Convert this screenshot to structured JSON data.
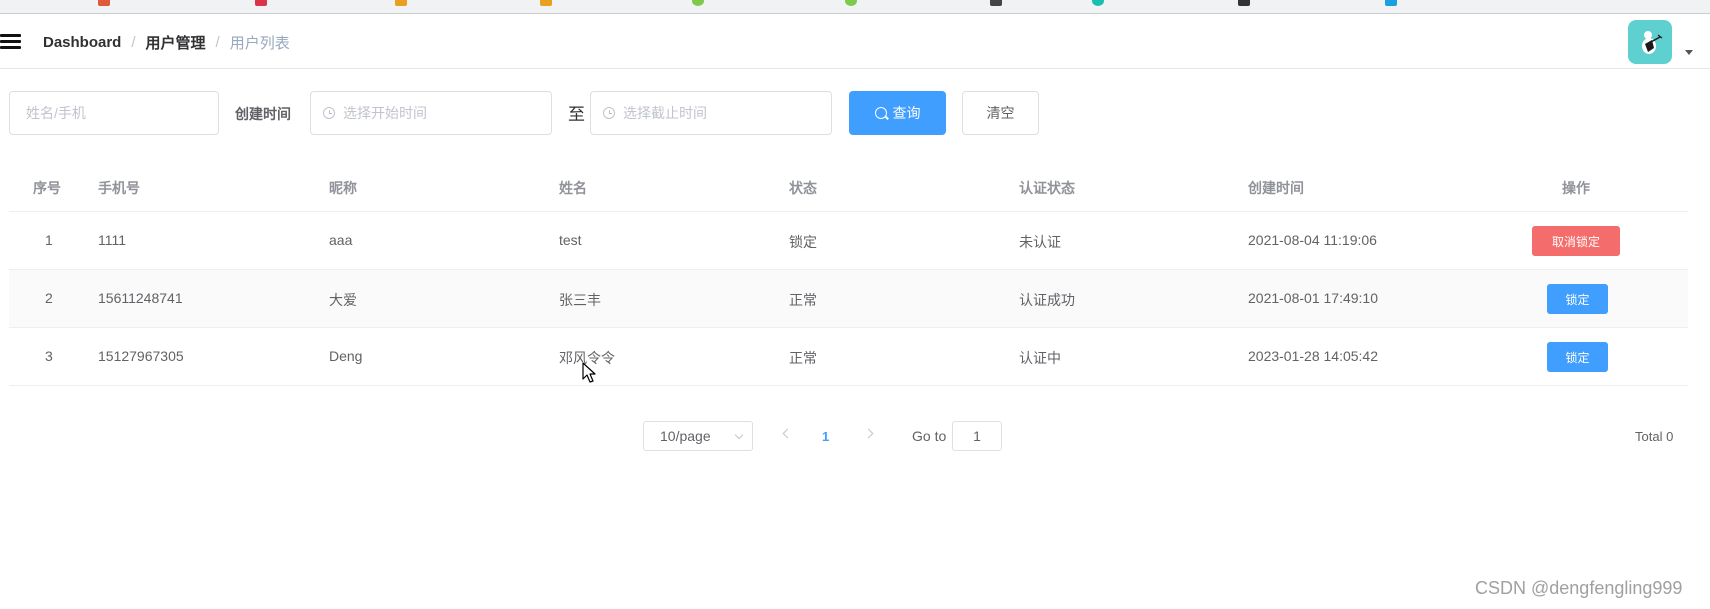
{
  "navbar": {
    "breadcrumb": [
      "Dashboard",
      "用户管理",
      "用户列表"
    ],
    "crumb_separator": "/"
  },
  "filters": {
    "name_placeholder": "姓名/手机",
    "created_label": "创建时间",
    "start_placeholder": "选择开始时间",
    "to_label": "至",
    "end_placeholder": "选择截止时间",
    "query_label": "查询",
    "clear_label": "清空"
  },
  "table": {
    "columns": [
      "序号",
      "手机号",
      "昵称",
      "姓名",
      "状态",
      "认证状态",
      "创建时间",
      "操作"
    ],
    "rows": [
      {
        "index": "1",
        "phone": "1111",
        "nickname": "aaa",
        "name": "test",
        "status": "锁定",
        "auth": "未认证",
        "created": "2021-08-04 11:19:06",
        "action": "取消锁定"
      },
      {
        "index": "2",
        "phone": "15611248741",
        "nickname": "大爱",
        "name": "张三丰",
        "status": "正常",
        "auth": "认证成功",
        "created": "2021-08-01 17:49:10",
        "action": "锁定"
      },
      {
        "index": "3",
        "phone": "15127967305",
        "nickname": "Deng",
        "name": "邓风令令",
        "status": "正常",
        "auth": "认证中",
        "created": "2023-01-28 14:05:42",
        "action": "锁定"
      }
    ]
  },
  "pagination": {
    "page_size": "10/page",
    "current_page": "1",
    "goto_label": "Go to",
    "goto_value": "1",
    "total": "Total 0"
  },
  "watermark": "CSDN @dengfengling999",
  "colors": {
    "primary": "#409eff",
    "danger": "#f56c6c",
    "avatar_bg": "#5fd0d0"
  }
}
